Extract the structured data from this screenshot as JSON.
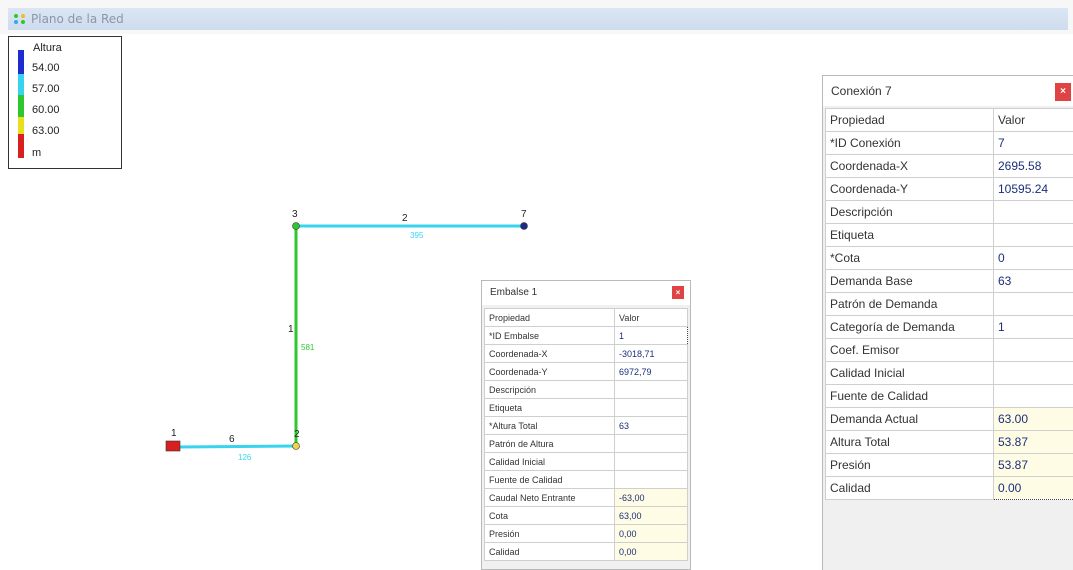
{
  "window": {
    "title": "Plano de la Red",
    "icon": "network-map-icon"
  },
  "legend": {
    "title": "Altura",
    "values": [
      "54.00",
      "57.00",
      "60.00",
      "63.00",
      "m"
    ],
    "colors": [
      "#1d2bcf",
      "#38d4ef",
      "#2ec82e",
      "#e9e01d",
      "#d82020"
    ]
  },
  "network": {
    "nodes": [
      {
        "id": "3",
        "color": "#2ec82e"
      },
      {
        "id": "7",
        "color": "#1d2a8a"
      },
      {
        "id": "2",
        "color": "#f0d24a"
      },
      {
        "id": "1",
        "type": "reservoir",
        "color": "#d82020"
      }
    ],
    "links": [
      {
        "id": "2",
        "length": "395",
        "color": "#38d4ef"
      },
      {
        "id": "1",
        "length": "581",
        "color": "#2ec82e"
      },
      {
        "id": "6",
        "length": "126",
        "color": "#38d4ef"
      }
    ]
  },
  "embalse": {
    "title": "Embalse 1",
    "close_icon": "×",
    "header": {
      "prop": "Propiedad",
      "val": "Valor"
    },
    "rows": [
      {
        "prop": "*ID Embalse",
        "val": "1"
      },
      {
        "prop": "Coordenada-X",
        "val": "-3018,71"
      },
      {
        "prop": "Coordenada-Y",
        "val": "6972,79"
      },
      {
        "prop": "Descripción",
        "val": ""
      },
      {
        "prop": "Etiqueta",
        "val": ""
      },
      {
        "prop": "*Altura Total",
        "val": "63"
      },
      {
        "prop": "Patrón de Altura",
        "val": ""
      },
      {
        "prop": "Calidad Inicial",
        "val": ""
      },
      {
        "prop": "Fuente de Calidad",
        "val": ""
      },
      {
        "prop": "Caudal Neto Entrante",
        "val": "-63,00"
      },
      {
        "prop": "Cota",
        "val": "63,00"
      },
      {
        "prop": "Presión",
        "val": "0,00"
      },
      {
        "prop": "Calidad",
        "val": "0,00"
      }
    ]
  },
  "conexion": {
    "title": "Conexión 7",
    "close_icon": "×",
    "header": {
      "prop": "Propiedad",
      "val": "Valor"
    },
    "rows": [
      {
        "prop": "*ID Conexión",
        "val": "7"
      },
      {
        "prop": "Coordenada-X",
        "val": "2695.58"
      },
      {
        "prop": "Coordenada-Y",
        "val": "10595.24"
      },
      {
        "prop": "Descripción",
        "val": ""
      },
      {
        "prop": "Etiqueta",
        "val": ""
      },
      {
        "prop": "*Cota",
        "val": "0"
      },
      {
        "prop": "Demanda Base",
        "val": "63"
      },
      {
        "prop": "Patrón de Demanda",
        "val": ""
      },
      {
        "prop": "Categoría de Demanda",
        "val": "1"
      },
      {
        "prop": "Coef. Emisor",
        "val": ""
      },
      {
        "prop": "Calidad Inicial",
        "val": ""
      },
      {
        "prop": "Fuente de Calidad",
        "val": ""
      },
      {
        "prop": "Demanda Actual",
        "val": "63.00"
      },
      {
        "prop": "Altura Total",
        "val": "53.87"
      },
      {
        "prop": "Presión",
        "val": "53.87"
      },
      {
        "prop": "Calidad",
        "val": "0.00"
      }
    ]
  }
}
